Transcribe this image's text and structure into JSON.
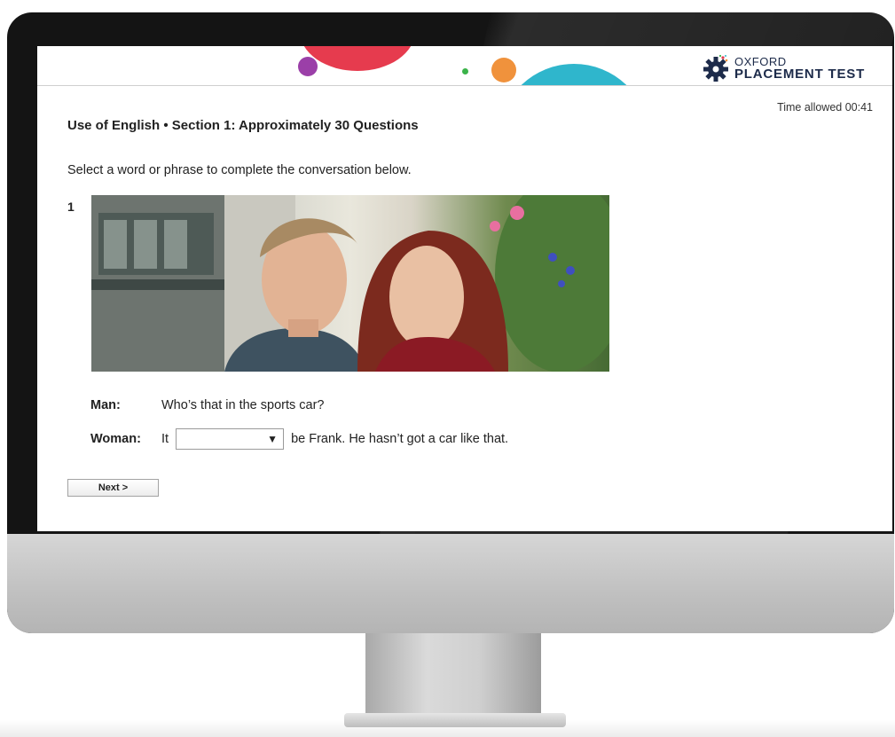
{
  "header": {
    "logo_line1": "OXFORD",
    "logo_line2": "PLACEMENT TEST",
    "timer": "Time allowed 00:41"
  },
  "main": {
    "section_title": "Use of English • Section 1: Approximately 30 Questions",
    "instructions": "Select a word or phrase to complete the conversation below.",
    "question_number": "1",
    "conversation": {
      "man_label": "Man:",
      "man_line": "Who’s that in the sports car?",
      "woman_label": "Woman:",
      "woman_before": "It",
      "dropdown_value": "",
      "dropdown_arrow": "▼",
      "woman_after": "be Frank. He hasn’t got a car like that."
    },
    "next_label": "Next >"
  },
  "colors": {
    "deco_red": "#e63b4e",
    "deco_purple": "#9b3fa8",
    "deco_green": "#3bb34a",
    "deco_orange": "#f0923c",
    "deco_teal": "#2fb6cc",
    "logo_navy": "#1d2b4a"
  },
  "icons": {
    "logo": "gear-icon",
    "dropdown": "caret-down-icon"
  }
}
